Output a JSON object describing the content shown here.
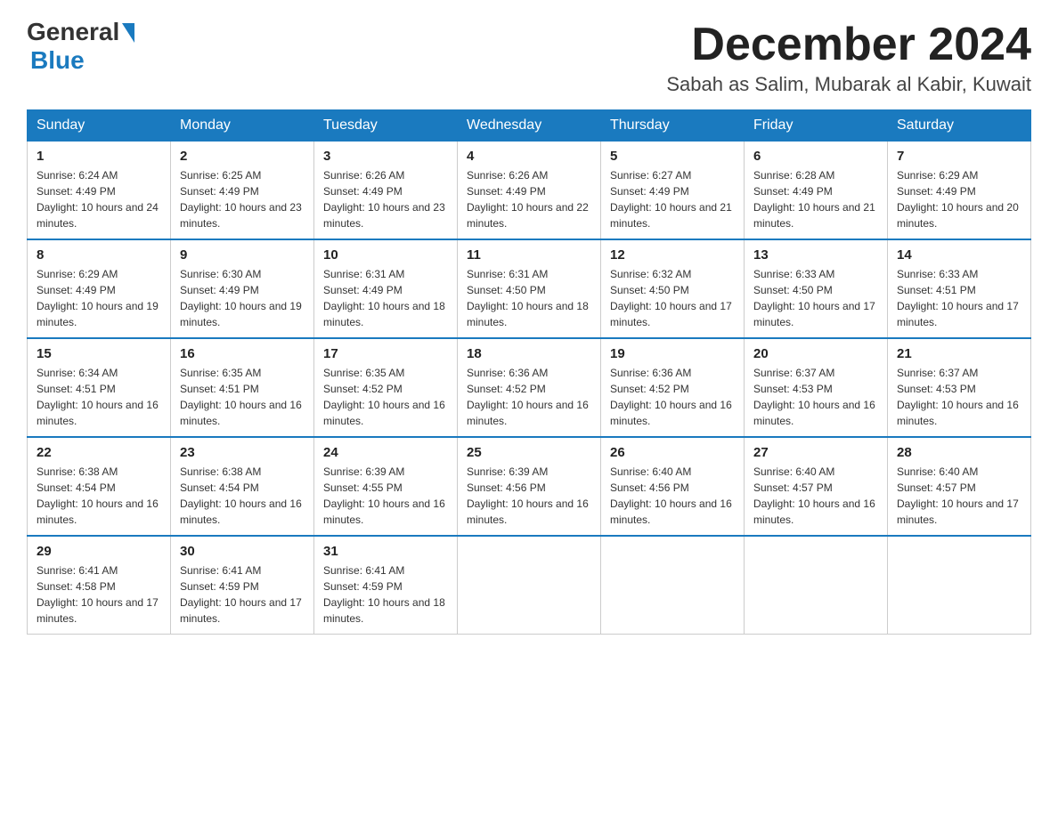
{
  "header": {
    "logo_general": "General",
    "logo_blue": "Blue",
    "month_title": "December 2024",
    "location": "Sabah as Salim, Mubarak al Kabir, Kuwait"
  },
  "weekdays": [
    "Sunday",
    "Monday",
    "Tuesday",
    "Wednesday",
    "Thursday",
    "Friday",
    "Saturday"
  ],
  "weeks": [
    [
      {
        "day": "1",
        "sunrise": "6:24 AM",
        "sunset": "4:49 PM",
        "daylight": "10 hours and 24 minutes."
      },
      {
        "day": "2",
        "sunrise": "6:25 AM",
        "sunset": "4:49 PM",
        "daylight": "10 hours and 23 minutes."
      },
      {
        "day": "3",
        "sunrise": "6:26 AM",
        "sunset": "4:49 PM",
        "daylight": "10 hours and 23 minutes."
      },
      {
        "day": "4",
        "sunrise": "6:26 AM",
        "sunset": "4:49 PM",
        "daylight": "10 hours and 22 minutes."
      },
      {
        "day": "5",
        "sunrise": "6:27 AM",
        "sunset": "4:49 PM",
        "daylight": "10 hours and 21 minutes."
      },
      {
        "day": "6",
        "sunrise": "6:28 AM",
        "sunset": "4:49 PM",
        "daylight": "10 hours and 21 minutes."
      },
      {
        "day": "7",
        "sunrise": "6:29 AM",
        "sunset": "4:49 PM",
        "daylight": "10 hours and 20 minutes."
      }
    ],
    [
      {
        "day": "8",
        "sunrise": "6:29 AM",
        "sunset": "4:49 PM",
        "daylight": "10 hours and 19 minutes."
      },
      {
        "day": "9",
        "sunrise": "6:30 AM",
        "sunset": "4:49 PM",
        "daylight": "10 hours and 19 minutes."
      },
      {
        "day": "10",
        "sunrise": "6:31 AM",
        "sunset": "4:49 PM",
        "daylight": "10 hours and 18 minutes."
      },
      {
        "day": "11",
        "sunrise": "6:31 AM",
        "sunset": "4:50 PM",
        "daylight": "10 hours and 18 minutes."
      },
      {
        "day": "12",
        "sunrise": "6:32 AM",
        "sunset": "4:50 PM",
        "daylight": "10 hours and 17 minutes."
      },
      {
        "day": "13",
        "sunrise": "6:33 AM",
        "sunset": "4:50 PM",
        "daylight": "10 hours and 17 minutes."
      },
      {
        "day": "14",
        "sunrise": "6:33 AM",
        "sunset": "4:51 PM",
        "daylight": "10 hours and 17 minutes."
      }
    ],
    [
      {
        "day": "15",
        "sunrise": "6:34 AM",
        "sunset": "4:51 PM",
        "daylight": "10 hours and 16 minutes."
      },
      {
        "day": "16",
        "sunrise": "6:35 AM",
        "sunset": "4:51 PM",
        "daylight": "10 hours and 16 minutes."
      },
      {
        "day": "17",
        "sunrise": "6:35 AM",
        "sunset": "4:52 PM",
        "daylight": "10 hours and 16 minutes."
      },
      {
        "day": "18",
        "sunrise": "6:36 AM",
        "sunset": "4:52 PM",
        "daylight": "10 hours and 16 minutes."
      },
      {
        "day": "19",
        "sunrise": "6:36 AM",
        "sunset": "4:52 PM",
        "daylight": "10 hours and 16 minutes."
      },
      {
        "day": "20",
        "sunrise": "6:37 AM",
        "sunset": "4:53 PM",
        "daylight": "10 hours and 16 minutes."
      },
      {
        "day": "21",
        "sunrise": "6:37 AM",
        "sunset": "4:53 PM",
        "daylight": "10 hours and 16 minutes."
      }
    ],
    [
      {
        "day": "22",
        "sunrise": "6:38 AM",
        "sunset": "4:54 PM",
        "daylight": "10 hours and 16 minutes."
      },
      {
        "day": "23",
        "sunrise": "6:38 AM",
        "sunset": "4:54 PM",
        "daylight": "10 hours and 16 minutes."
      },
      {
        "day": "24",
        "sunrise": "6:39 AM",
        "sunset": "4:55 PM",
        "daylight": "10 hours and 16 minutes."
      },
      {
        "day": "25",
        "sunrise": "6:39 AM",
        "sunset": "4:56 PM",
        "daylight": "10 hours and 16 minutes."
      },
      {
        "day": "26",
        "sunrise": "6:40 AM",
        "sunset": "4:56 PM",
        "daylight": "10 hours and 16 minutes."
      },
      {
        "day": "27",
        "sunrise": "6:40 AM",
        "sunset": "4:57 PM",
        "daylight": "10 hours and 16 minutes."
      },
      {
        "day": "28",
        "sunrise": "6:40 AM",
        "sunset": "4:57 PM",
        "daylight": "10 hours and 17 minutes."
      }
    ],
    [
      {
        "day": "29",
        "sunrise": "6:41 AM",
        "sunset": "4:58 PM",
        "daylight": "10 hours and 17 minutes."
      },
      {
        "day": "30",
        "sunrise": "6:41 AM",
        "sunset": "4:59 PM",
        "daylight": "10 hours and 17 minutes."
      },
      {
        "day": "31",
        "sunrise": "6:41 AM",
        "sunset": "4:59 PM",
        "daylight": "10 hours and 18 minutes."
      },
      null,
      null,
      null,
      null
    ]
  ]
}
